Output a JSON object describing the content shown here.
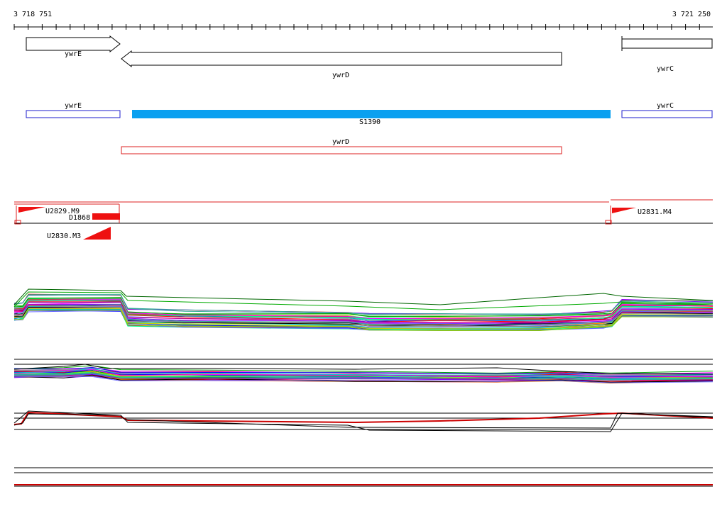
{
  "coordinates": {
    "start": "3 718 751",
    "end": "3 721 250"
  },
  "genes": [
    {
      "label": "ywrE",
      "strand": "+"
    },
    {
      "label": "ywrD",
      "strand": "-"
    },
    {
      "label": "ywrC",
      "strand": "+"
    }
  ],
  "transcripts": {
    "labels": [
      "ywrE",
      "S1390",
      "ywrC",
      "ywrD"
    ]
  },
  "features": [
    {
      "label": "U2829.M9"
    },
    {
      "label": "D1868"
    },
    {
      "label": "U2830.M3"
    },
    {
      "label": "U2831.M4"
    }
  ],
  "colors": {
    "gene_outline": "#000000",
    "transcript_blue": "#1e1ecc",
    "transcript_fill": "#0aa0f0",
    "transcript_red": "#dd2222",
    "feature_red": "#ee1111"
  }
}
